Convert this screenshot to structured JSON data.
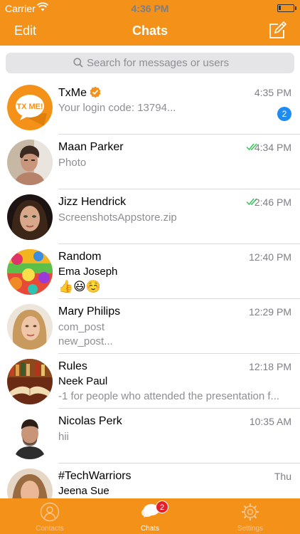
{
  "status_bar": {
    "carrier": "Carrier",
    "time": "4:36 PM"
  },
  "nav": {
    "edit_label": "Edit",
    "title": "Chats",
    "compose_icon": "compose-icon"
  },
  "search": {
    "placeholder": "Search for messages or users"
  },
  "colors": {
    "accent": "#f39118",
    "unread_badge": "#1e8cf0",
    "tab_badge": "#e3202b",
    "read_ticks": "#34c759"
  },
  "chats": [
    {
      "name": "TxMe",
      "verified": true,
      "time": "4:35 PM",
      "preview": "Your login code: 13794...",
      "unread": "2"
    },
    {
      "name": "Maan Parker",
      "time": "4:34 PM",
      "preview": "Photo",
      "read_ticks": true
    },
    {
      "name": "Jizz Hendrick",
      "time": "2:46 PM",
      "preview": "ScreenshotsAppstore.zip",
      "read_ticks": true
    },
    {
      "name": "Random",
      "time": "12:40 PM",
      "sender": "Ema Joseph",
      "preview": "👍😃☺️"
    },
    {
      "name": "Mary Philips",
      "time": "12:29 PM",
      "preview": "com_post",
      "preview2": "new_post..."
    },
    {
      "name": "Rules",
      "time": "12:18 PM",
      "sender": "Neek Paul",
      "preview": "-1 for people who attended the presentation f..."
    },
    {
      "name": "Nicolas Perk",
      "time": "10:35 AM",
      "preview": "hii"
    },
    {
      "name": "#TechWarriors",
      "time": "Thu",
      "sender": "Jeena Sue"
    }
  ],
  "tabs": [
    {
      "label": "Contacts",
      "icon": "contacts-icon"
    },
    {
      "label": "Chats",
      "icon": "chats-icon",
      "badge": "2",
      "active": true
    },
    {
      "label": "Settings",
      "icon": "settings-icon"
    }
  ]
}
